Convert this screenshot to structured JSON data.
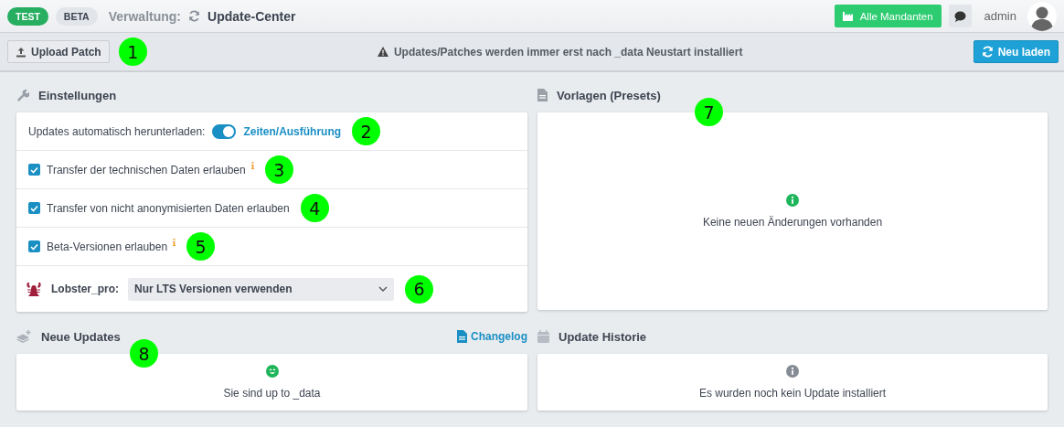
{
  "header": {
    "badges": [
      {
        "label": "TEST",
        "kind": "env"
      },
      {
        "label": "BETA",
        "kind": "plain"
      }
    ],
    "section": "Verwaltung:",
    "page_title": "Update-Center",
    "clients_button": "Alle Mandanten",
    "user": "admin"
  },
  "toolbar": {
    "upload_button": "Upload Patch",
    "upload_callout": "1",
    "notice": "Updates/Patches werden immer erst nach _data Neustart installiert",
    "reload_button": "Neu laden"
  },
  "settings": {
    "title": "Einstellungen",
    "rows": [
      {
        "kind": "toggle",
        "label": "Updates automatisch herunterladen:",
        "on": true,
        "link": "Zeiten/Ausführung",
        "callout": "2"
      },
      {
        "kind": "checkbox",
        "label": "Transfer der technischen Daten erlauben",
        "checked": true,
        "info": true,
        "callout": "3"
      },
      {
        "kind": "checkbox",
        "label": "Transfer von nicht anonymisierten Daten erlauben",
        "checked": true,
        "info": false,
        "callout": "4"
      },
      {
        "kind": "checkbox",
        "label": "Beta-Versionen erlauben",
        "checked": true,
        "info": true,
        "callout": "5"
      },
      {
        "kind": "select",
        "label": "Lobster_pro:",
        "value": "Nur LTS Versionen verwenden",
        "callout": "6"
      }
    ]
  },
  "presets": {
    "title": "Vorlagen (Presets)",
    "message": "Keine neuen Änderungen vorhanden",
    "kind": "success",
    "callout": "7"
  },
  "new_updates": {
    "title": "Neue Updates",
    "link": "Changelog",
    "message": "Sie sind up to _data",
    "kind": "happy",
    "callout": "8"
  },
  "history": {
    "title": "Update Historie",
    "message": "Es wurden noch kein Update installiert",
    "kind": "neutral"
  }
}
